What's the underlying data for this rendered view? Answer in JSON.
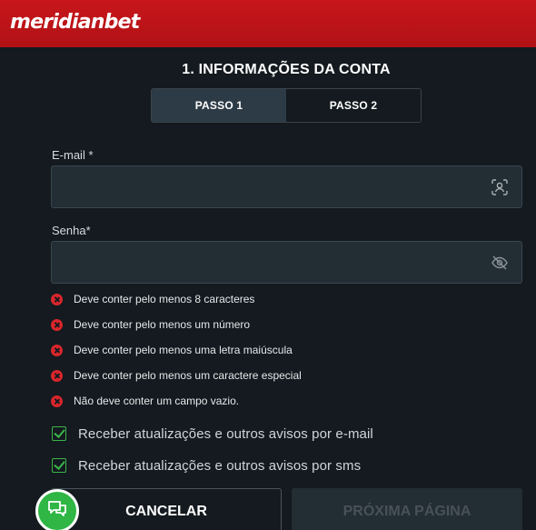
{
  "header": {
    "logo_text": "meridianbet",
    "brand_color": "#c8161b"
  },
  "form": {
    "title": "1. INFORMAÇÕES DA CONTA",
    "steps": [
      {
        "label": "PASSO 1",
        "active": true
      },
      {
        "label": "PASSO 2",
        "active": false
      }
    ],
    "email": {
      "label": "E-mail *",
      "value": "",
      "icon": "user-scan-icon"
    },
    "password": {
      "label": "Senha*",
      "value": "",
      "icon": "eye-off-icon"
    },
    "password_rules": [
      "Deve conter pelo menos 8 caracteres",
      "Deve conter pelo menos um número",
      "Deve conter pelo menos uma letra maiúscula",
      "Deve conter pelo menos um caractere especial",
      "Não deve conter um campo vazio."
    ],
    "rule_status_color": "#d9262c",
    "checkboxes": [
      {
        "label": "Receber atualizações e outros avisos por e-mail",
        "checked": true
      },
      {
        "label": "Receber atualizações e outros avisos por sms",
        "checked": true
      }
    ],
    "check_color": "#3bb54a",
    "buttons": {
      "cancel": "CANCELAR",
      "next": "PRÓXIMA PÁGINA"
    }
  },
  "chat_widget": {
    "icon": "chat-icon",
    "color": "#2fb644"
  }
}
